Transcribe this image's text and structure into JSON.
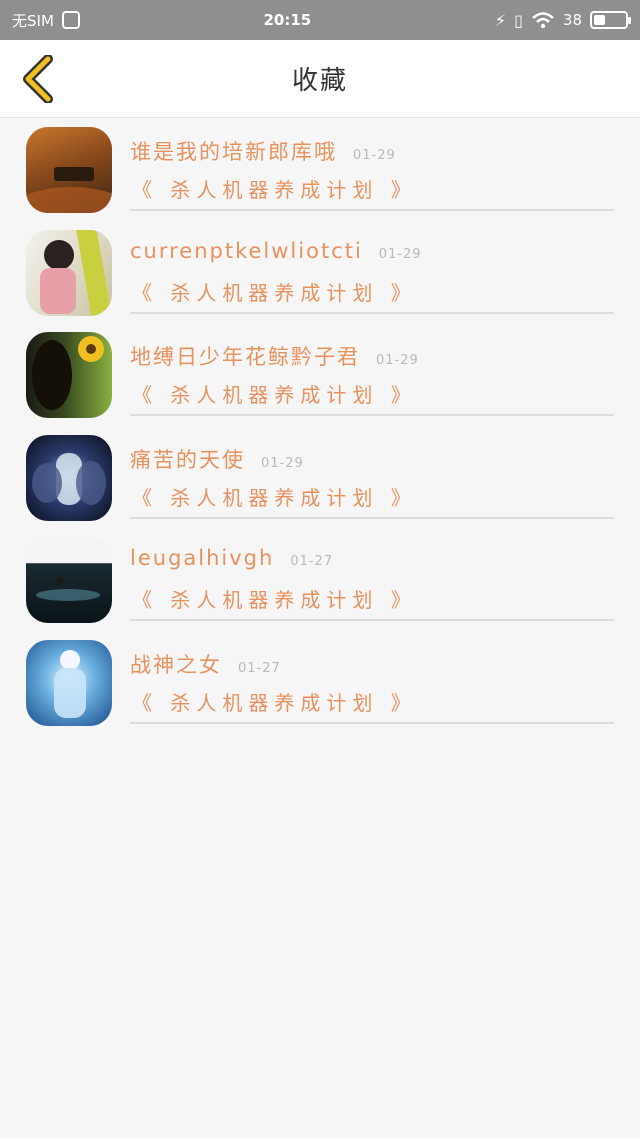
{
  "status_bar": {
    "carrier": "无SIM",
    "time": "20:15",
    "battery_percent": "38",
    "battery_level": 0.38
  },
  "header": {
    "title": "收藏",
    "back_icon": "chevron-left-icon",
    "accent": "#f0c020"
  },
  "favorites": [
    {
      "name": "谁是我的培新郎库哦",
      "date": "01-29",
      "book": "《 杀人机器养成计划 》"
    },
    {
      "name": "currenptkelwliotcti",
      "date": "01-29",
      "book": "《 杀人机器养成计划 》"
    },
    {
      "name": "地缚日少年花鲸黔子君",
      "date": "01-29",
      "book": "《 杀人机器养成计划 》"
    },
    {
      "name": "痛苦的天使",
      "date": "01-29",
      "book": "《 杀人机器养成计划 》"
    },
    {
      "name": "leugalhivgh",
      "date": "01-27",
      "book": "《 杀人机器养成计划 》"
    },
    {
      "name": "战神之女",
      "date": "01-27",
      "book": "《 杀人机器养成计划 》"
    }
  ],
  "colors": {
    "text_accent": "#e8925f",
    "date": "#b8b8b8",
    "status_bar": "#8f8f8f"
  }
}
